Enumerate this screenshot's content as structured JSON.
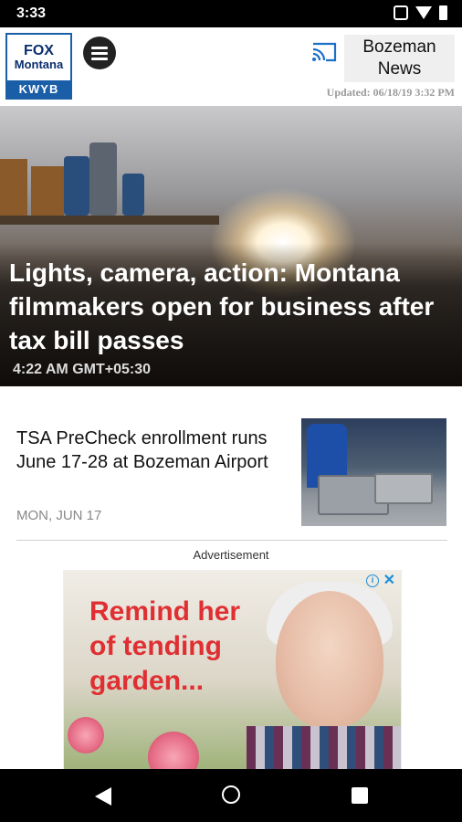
{
  "status_bar": {
    "time": "3:33"
  },
  "header": {
    "logo": {
      "line1": "FOX",
      "line2": "Montana",
      "callsign": "KWYB"
    },
    "edition_button": {
      "line1": "Bozeman",
      "line2": "News"
    },
    "updated": "Updated: 06/18/19 3:32 PM"
  },
  "hero": {
    "title": "Lights, camera, action: Montana filmmakers open for business after tax bill passes",
    "time": "4:22 AM GMT+05:30"
  },
  "article": {
    "title": "TSA PreCheck enrollment runs June 17-28 at Bozeman Airport",
    "date": "MON, JUN 17"
  },
  "ad": {
    "label": "Advertisement",
    "text": "Remind her of tending garden..."
  },
  "colors": {
    "ad_text": "#e02f33",
    "logo_blue": "#1b5ea8",
    "status_bar": "#000000"
  }
}
